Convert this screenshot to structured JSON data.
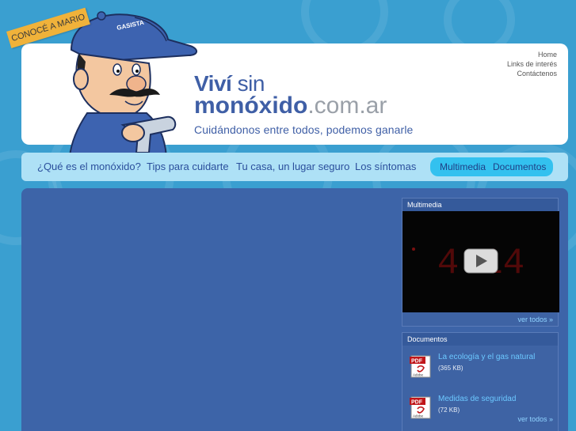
{
  "badge": {
    "label": "CONOCÉ A MARIO"
  },
  "mascot": {
    "cap_text": "GASISTA"
  },
  "logo": {
    "line1_bold": "Viví",
    "line1_light": "sin",
    "line2_bold": "monóxido",
    "line2_domain": ".com.ar",
    "tagline": "Cuidándonos entre todos, podemos ganarle"
  },
  "top_links": [
    "Home",
    "Links de interés",
    "Contáctenos"
  ],
  "nav": {
    "items": [
      "¿Qué es el monóxido?",
      "Tips para cuidarte",
      "Tu casa, un lugar seguro",
      "Los síntomas"
    ],
    "pill_items": [
      "Multimedia",
      "Documentos"
    ]
  },
  "multimedia": {
    "title": "Multimedia",
    "video_text": "4:14",
    "ver_todos": "ver todos »"
  },
  "documentos": {
    "title": "Documentos",
    "items": [
      {
        "label": "La ecología y el gas natural",
        "size": "(365 KB)"
      },
      {
        "label": "Medidas de seguridad",
        "size": "(72 KB)"
      }
    ],
    "ver_todos": "ver todos »"
  },
  "colors": {
    "background": "#3a9fd0",
    "navbar": "#aee1f6",
    "nav_pill": "#33c1ef",
    "main_panel": "#3d64a8",
    "logo_blue": "#3f5fa6",
    "badge": "#f0b23a"
  },
  "icons": [
    "pdf-icon",
    "play-icon",
    "mascot-illustration"
  ]
}
